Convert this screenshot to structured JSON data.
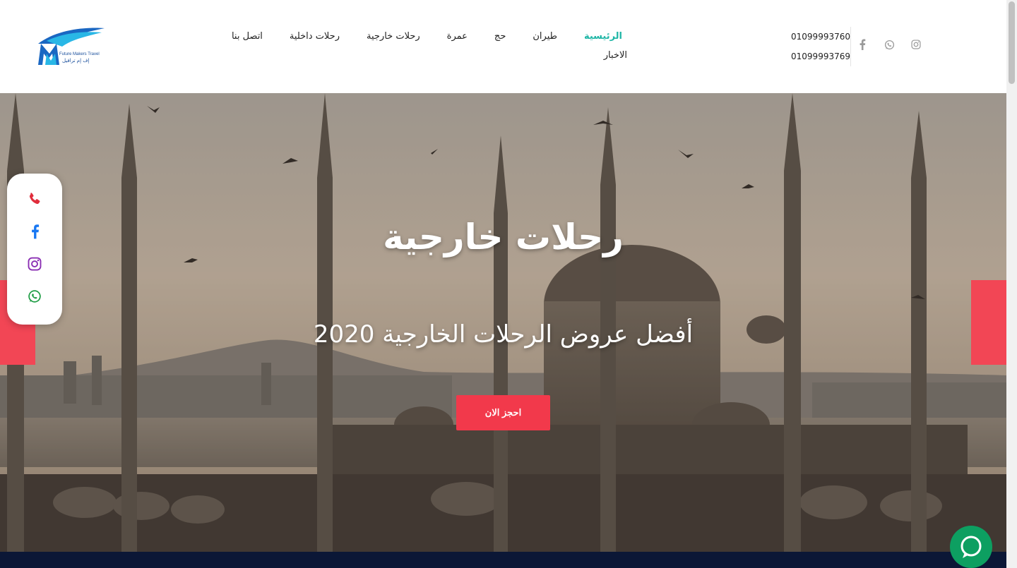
{
  "brand": {
    "logo_text_en": "Future Makers Travel",
    "logo_text_ar": "إف إم ترافيل",
    "accent_color": "#1fb6a6",
    "primary_red": "#f2394b"
  },
  "nav": {
    "items": [
      {
        "label": "الرئيسية",
        "active": true
      },
      {
        "label": "طيران"
      },
      {
        "label": "حج"
      },
      {
        "label": "عمرة"
      },
      {
        "label": "رحلات خارجية"
      },
      {
        "label": "رحلات داخلية"
      },
      {
        "label": "اتصل بنا"
      }
    ],
    "second_row": [
      {
        "label": "الاخبار"
      }
    ]
  },
  "contact": {
    "phones": [
      "01099993760",
      "01099993769"
    ]
  },
  "header_social": [
    "facebook-icon",
    "whatsapp-icon",
    "instagram-icon"
  ],
  "hero": {
    "title": "رحلات خارجية",
    "subtitle": "أفضل عروض الرحلات الخارجية 2020",
    "cta_label": "احجز الان"
  },
  "floating_social": [
    "phone-icon",
    "facebook-icon",
    "instagram-icon",
    "whatsapp-icon"
  ],
  "colors": {
    "footer_strip": "#0b1736",
    "chat_button": "#0d9f61",
    "side_tab": "#f24655"
  }
}
